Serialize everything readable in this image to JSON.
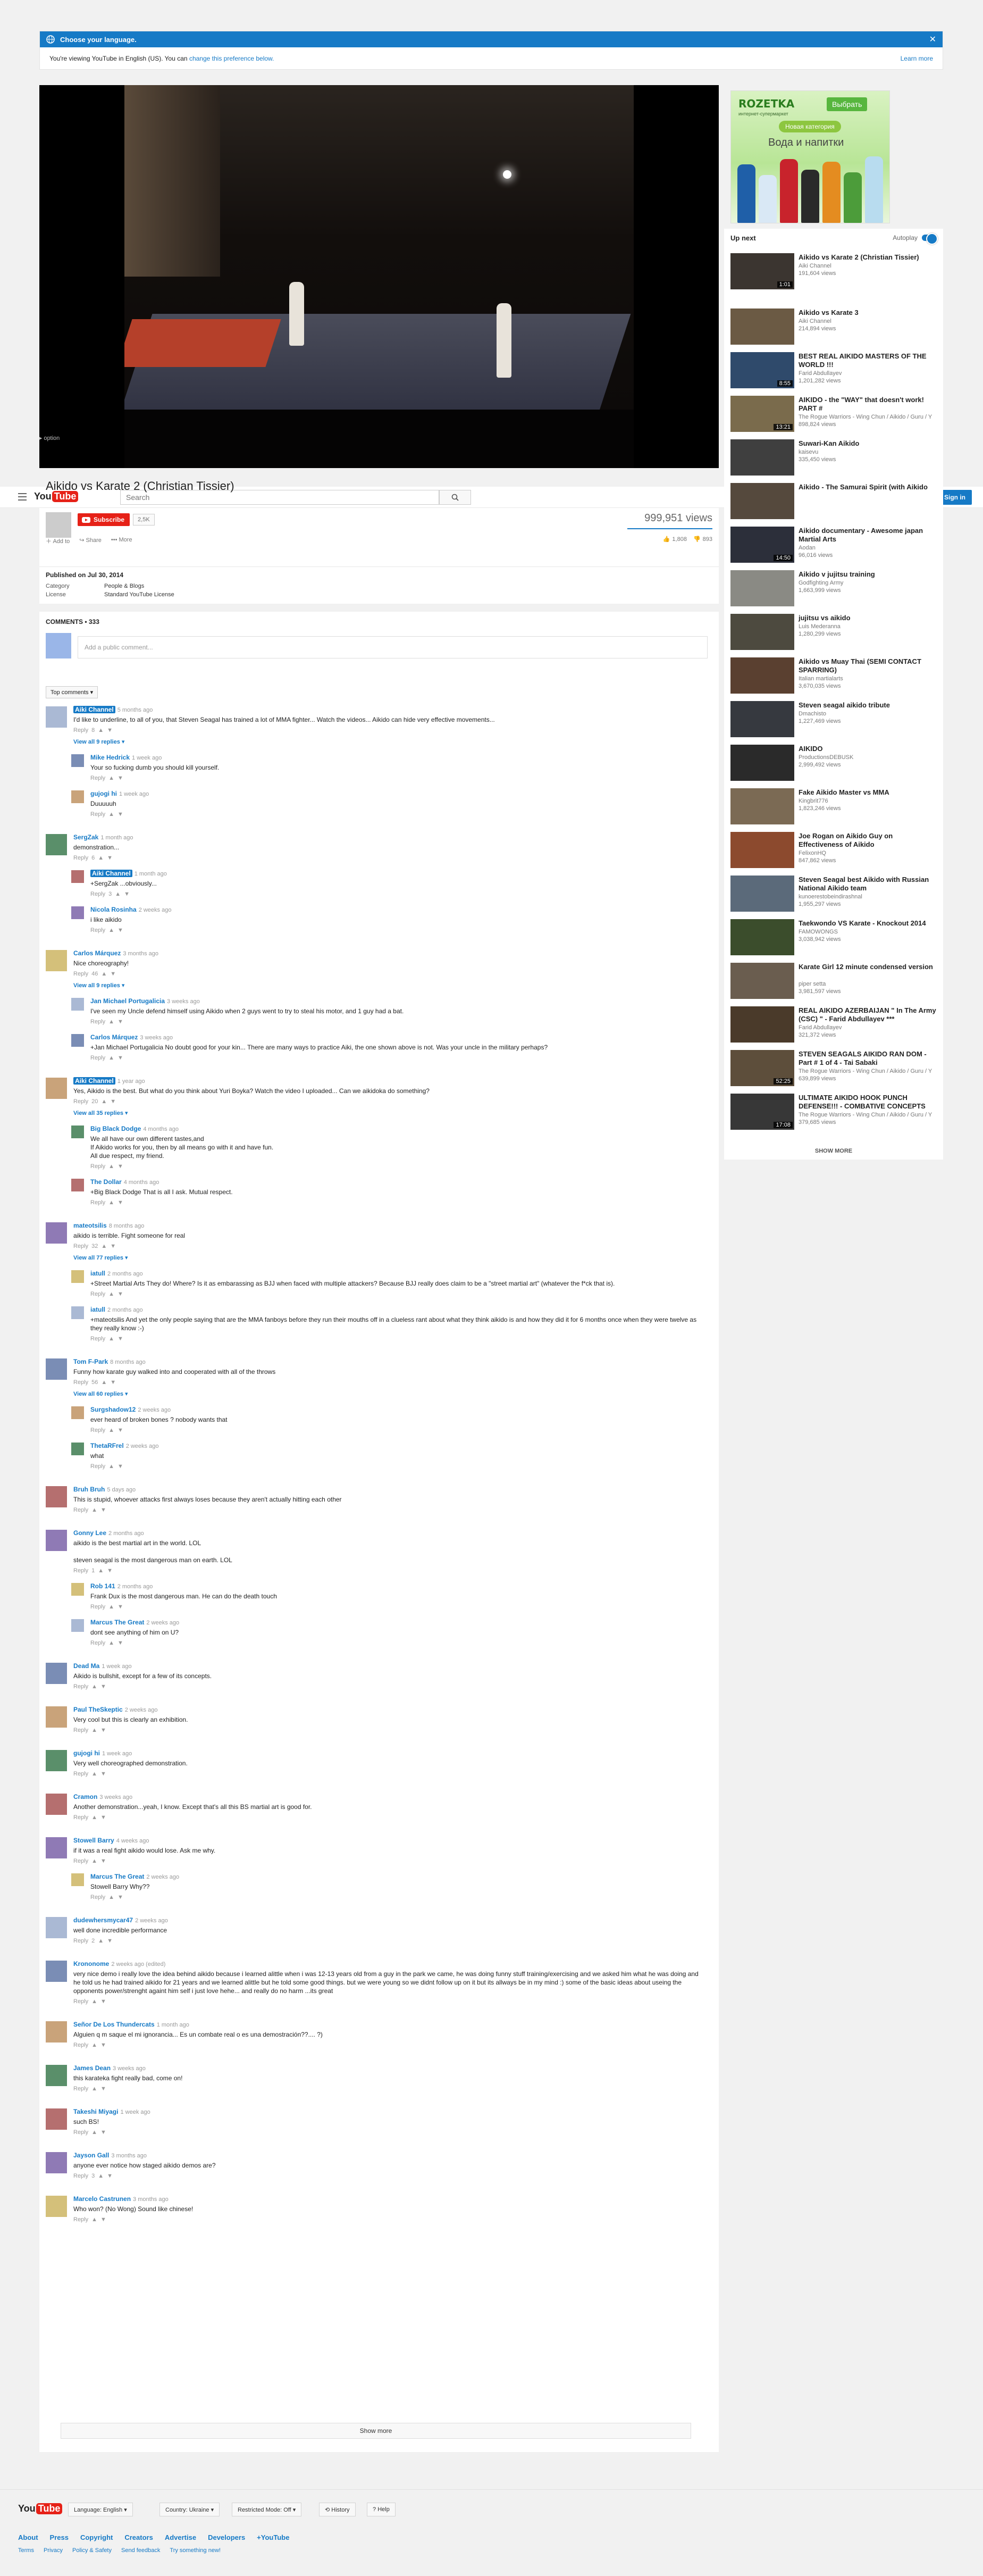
{
  "banner": {
    "title": "Choose your language.",
    "message": "You're viewing YouTube in English (US). You can",
    "change_link": "change this preference below.",
    "learn_more": "Learn more"
  },
  "player": {
    "skip_ad": "Skip ad ▸ option"
  },
  "ad": {
    "brand": "ROZETKA",
    "cta": "Выбрать",
    "sub": "интернет-супермаркет",
    "pill": "Новая категория",
    "headline": "Вода и напитки"
  },
  "masthead": {
    "logo_you": "You",
    "logo_tube": "Tube",
    "search_placeholder": "Search",
    "sign_in": "Sign in"
  },
  "video": {
    "title": "Aikido vs Karate 2 (Christian Tissier)",
    "subscribe": "Subscribe",
    "subscriber_count": "2,5K",
    "views": "999,951 views",
    "add_to": "Add to",
    "share": "Share",
    "more": "More",
    "likes": "1,808",
    "dislikes": "893",
    "published": "Published on Jul 30, 2014",
    "category_label": "Category",
    "category": "People & Blogs",
    "license_label": "License",
    "license": "Standard YouTube License"
  },
  "upnext": {
    "title": "Up next",
    "autoplay": "Autoplay",
    "show_more": "SHOW MORE",
    "items": [
      {
        "title": "Aikido vs Karate 2 (Christian Tissier)",
        "channel": "Aiki Channel",
        "views": "191,604 views",
        "duration": "1:01"
      },
      {
        "title": "Aikido vs Karate 3",
        "channel": "Aiki Channel",
        "views": "214,894 views",
        "duration": ""
      },
      {
        "title": "BEST REAL AIKIDO MASTERS OF THE WORLD !!!",
        "channel": "Farid Abdullayev",
        "views": "1,201,282 views",
        "duration": "8:55"
      },
      {
        "title": "AIKIDO - the \"WAY\" that doesn't work! PART #",
        "channel": "The Rogue Warriors - Wing Chun / Aikido / Guru / Y",
        "views": "898,824 views",
        "duration": "13:21"
      },
      {
        "title": "Suwari-Kan Aikido",
        "channel": "kaisevu",
        "views": "335,450 views",
        "duration": ""
      },
      {
        "title": "Aikido - The Samurai Spirit (with Aikido",
        "channel": "",
        "views": "",
        "duration": ""
      },
      {
        "title": "Aikido documentary - Awesome japan Martial Arts",
        "channel": "Aodan",
        "views": "96,016 views",
        "duration": "14:50"
      },
      {
        "title": "Aikido v jujitsu training",
        "channel": "Godfighting Army",
        "views": "1,663,999 views",
        "duration": ""
      },
      {
        "title": "jujitsu vs aikido",
        "channel": "Luis Mederanna",
        "views": "1,280,299 views",
        "duration": ""
      },
      {
        "title": "Aikido vs Muay Thai (SEMI CONTACT SPARRING)",
        "channel": "Italian martialarts",
        "views": "3,670,035 views",
        "duration": ""
      },
      {
        "title": "Steven seagal aikido tribute",
        "channel": "Dmachisto",
        "views": "1,227,469 views",
        "duration": ""
      },
      {
        "title": "AIKIDO",
        "channel": "ProductionsDEBUSK",
        "views": "2,999,492 views",
        "duration": ""
      },
      {
        "title": "Fake Aikido Master vs MMA",
        "channel": "Kingbrit776",
        "views": "1,823,246 views",
        "duration": ""
      },
      {
        "title": "Joe Rogan on Aikido Guy on Effectiveness of Aikido",
        "channel": "FelixonHQ",
        "views": "847,862 views",
        "duration": ""
      },
      {
        "title": "Steven Seagal best Aikido with Russian National Aikido team",
        "channel": "kunoerestobeindirashnal",
        "views": "1,955,297 views",
        "duration": ""
      },
      {
        "title": "Taekwondo VS Karate - Knockout 2014",
        "channel": "FAMOWONGS",
        "views": "3,038,942 views",
        "duration": ""
      },
      {
        "title": "Karate Girl 12 minute condensed version",
        "channel": "piper setta",
        "views": "3,981,597 views",
        "duration": ""
      },
      {
        "title": "REAL AIKIDO AZERBAIJAN \" In The Army (CSC) \" - Farid Abdullayev ***",
        "channel": "Farid Abdullayev",
        "views": "321,372 views",
        "duration": ""
      },
      {
        "title": "STEVEN SEAGALS AIKIDO RAN DOM - Part # 1 of 4 - Tai Sabaki",
        "channel": "The Rogue Warriors - Wing Chun / Aikido / Guru / Y",
        "views": "639,899 views",
        "duration": "52:25"
      },
      {
        "title": "ULTIMATE AIKIDO HOOK PUNCH DEFENSE!!! - COMBATIVE CONCEPTS",
        "channel": "The Rogue Warriors - Wing Chun / Aikido / Guru / Y",
        "views": "379,685 views",
        "duration": "17:08"
      }
    ]
  },
  "comments": {
    "header": "COMMENTS • 333",
    "add_placeholder": "Add a public comment...",
    "sort": "Top comments ▾",
    "show_more": "Show more",
    "items": [
      {
        "author": "Aiki Channel",
        "hl": true,
        "time": "5 months ago",
        "text": "I'd like to underline, to all of you, that Steven Seagal has trained a lot of MMA fighter... Watch the videos... Aikido can hide very effective movements...",
        "likes": "8",
        "view_all": "View all 9 replies ▾",
        "reply": false
      },
      {
        "author": "Mike Hedrick",
        "hl": false,
        "time": "1 week ago",
        "text": "Your so fucking dumb you should kill yourself.",
        "likes": "",
        "view_all": "",
        "reply": true
      },
      {
        "author": "gujogi hi",
        "hl": false,
        "time": "1 week ago",
        "text": "Duuuuuh",
        "likes": "",
        "view_all": "",
        "reply": true
      },
      {
        "author": "SergZak",
        "hl": false,
        "time": "1 month ago",
        "text": "demonstration...",
        "likes": "6",
        "view_all": "",
        "reply": false
      },
      {
        "author": "Aiki Channel",
        "hl": true,
        "time": "1 month ago",
        "text": "+SergZak ...obviously...",
        "likes": "3",
        "view_all": "",
        "reply": true
      },
      {
        "author": "Nicola Rosinha",
        "hl": false,
        "time": "2 weeks ago",
        "text": "i like aikido",
        "likes": "",
        "view_all": "",
        "reply": true
      },
      {
        "author": "Carlos Márquez",
        "hl": false,
        "time": "3 months ago",
        "text": "Nice choreography!",
        "likes": "46",
        "view_all": "View all 9 replies ▾",
        "reply": false
      },
      {
        "author": "Jan Michael Portugalicia",
        "hl": false,
        "time": "3 weeks ago",
        "text": "I've seen my Uncle defend himself  using Aikido when 2 guys went to try to steal his motor, and 1 guy had a bat.",
        "likes": "",
        "view_all": "",
        "reply": true
      },
      {
        "author": "Carlos Márquez",
        "hl": false,
        "time": "3 weeks ago",
        "text": "+Jan Michael Portugalicia No doubt good for your kin... There are many ways to practice Aiki, the one shown above is not. Was your uncle in the military perhaps?",
        "likes": "",
        "view_all": "",
        "reply": true
      },
      {
        "author": "Aiki Channel",
        "hl": true,
        "time": "1 year ago",
        "text": "Yes, Aikido is the best. But what do you think about Yuri Boyka? Watch the video I uploaded... Can we aikidoka do something?",
        "likes": "20",
        "view_all": "View all 35 replies ▾",
        "reply": false
      },
      {
        "author": "Big Black Dodge",
        "hl": false,
        "time": "4 months ago",
        "text": "We all have our own different tastes,and\nIf Aikido works for you, then by all means go with it and have fun.\nAll due respect, my friend.",
        "likes": "",
        "view_all": "",
        "reply": true
      },
      {
        "author": "The Dollar",
        "hl": false,
        "time": "4 months ago",
        "text": "+Big Black Dodge That is all I ask. Mutual respect.",
        "likes": "",
        "view_all": "",
        "reply": true
      },
      {
        "author": "mateotsilis",
        "hl": false,
        "time": "8 months ago",
        "text": "aikido is terrible. Fight someone for real",
        "likes": "32",
        "view_all": "View all 77 replies ▾",
        "reply": false
      },
      {
        "author": "iatull",
        "hl": false,
        "time": "2 months ago",
        "text": "+Street Martial Arts  They do!  Where?  Is it as embarassing as BJJ when faced with multiple attackers?  Because BJJ really does claim to be a \"street martial art\" (whatever the f*ck that is).",
        "likes": "",
        "view_all": "",
        "reply": true
      },
      {
        "author": "iatull",
        "hl": false,
        "time": "2 months ago",
        "text": "+mateotsilis   And yet the only people saying that are the MMA fanboys before they run their mouths off in a clueless rant about what they think aikido is and how they did it for 6 months once when they were twelve as they really know :-)",
        "likes": "",
        "view_all": "",
        "reply": true
      },
      {
        "author": "Tom F-Park",
        "hl": false,
        "time": "8 months ago",
        "text": "Funny how karate guy walked into and cooperated with all of the throws",
        "likes": "56",
        "view_all": "View all 60 replies ▾",
        "reply": false
      },
      {
        "author": "Surgshadow12",
        "hl": false,
        "time": "2 weeks ago",
        "text": "ever heard of broken bones ? nobody wants that",
        "likes": "",
        "view_all": "",
        "reply": true
      },
      {
        "author": "ThetaRFrel",
        "hl": false,
        "time": "2 weeks ago",
        "text": "what",
        "likes": "",
        "view_all": "",
        "reply": true
      },
      {
        "author": "Bruh Bruh",
        "hl": false,
        "time": "5 days ago",
        "text": "This is stupid, whoever attacks first always loses because they aren't actually hitting each other",
        "likes": "",
        "view_all": "",
        "reply": false
      },
      {
        "author": "Gonny Lee",
        "hl": false,
        "time": "2 months ago",
        "text": "aikido is the best martial art in the world. LOL\n\nsteven seagal is the most dangerous man on earth. LOL",
        "likes": "1",
        "view_all": "",
        "reply": false
      },
      {
        "author": "Rob 141",
        "hl": false,
        "time": "2 months ago",
        "text": "Frank Dux is the most dangerous man. He can do the death touch",
        "likes": "",
        "view_all": "",
        "reply": true
      },
      {
        "author": "Marcus The Great",
        "hl": false,
        "time": "2 weeks ago",
        "text": "dont see anything of him on U?",
        "likes": "",
        "view_all": "",
        "reply": true
      },
      {
        "author": "Dead Ma",
        "hl": false,
        "time": "1 week ago",
        "text": "Aikido is bullshit, except for a few of its concepts.",
        "likes": "",
        "view_all": "",
        "reply": false
      },
      {
        "author": "Paul TheSkeptic",
        "hl": false,
        "time": "2 weeks ago",
        "text": "Very cool but this is clearly an exhibition.",
        "likes": "",
        "view_all": "",
        "reply": false
      },
      {
        "author": "gujogi hi",
        "hl": false,
        "time": "1 week ago",
        "text": "Very well choreographed demonstration.",
        "likes": "",
        "view_all": "",
        "reply": false
      },
      {
        "author": "Cramon",
        "hl": false,
        "time": "3 weeks ago",
        "text": "Another demonstration...yeah, I know. Except that's all this BS martial art is good for.",
        "likes": "",
        "view_all": "",
        "reply": false
      },
      {
        "author": "Stowell Barry",
        "hl": false,
        "time": "4 weeks ago",
        "text": "if it was a real fight aikido would lose. Ask me why.",
        "likes": "",
        "view_all": "",
        "reply": false
      },
      {
        "author": "Marcus The Great",
        "hl": false,
        "time": "2 weeks ago",
        "text": "Stowell Barry Why??",
        "likes": "",
        "view_all": "",
        "reply": true
      },
      {
        "author": "dudewhersmycar47",
        "hl": false,
        "time": "2 weeks ago",
        "text": "well done incredible performance",
        "likes": "2",
        "view_all": "",
        "reply": false
      },
      {
        "author": "Krononome",
        "hl": false,
        "time": "2 weeks ago (edited)",
        "text": "very nice demo i really love the idea behind aikido because i learned alittle when i was 12-13 years old from a guy in the park we came, he was doing funny stuff  training/exercising and we asked him what he was doing and he told us he had trained aikido for 21 years and we learned alittle but he told some good things. but we were young so we didnt follow up on it but its allways be in my mind :)  some of the basic ideas about useing the opponents power/strenght againt him self i just love hehe... and really do no harm ...its great",
        "likes": "",
        "view_all": "",
        "reply": false
      },
      {
        "author": "Señor De Los Thundercats",
        "hl": false,
        "time": "1 month ago",
        "text": "Alguien q m saque el mi ignorancia... Es un combate real o es una demostración??.... ?)",
        "likes": "",
        "view_all": "",
        "reply": false
      },
      {
        "author": "James Dean",
        "hl": false,
        "time": "3 weeks ago",
        "text": "this karateka fight really bad, come on!",
        "likes": "",
        "view_all": "",
        "reply": false
      },
      {
        "author": "Takeshi Miyagi",
        "hl": false,
        "time": "1 week ago",
        "text": "such BS!",
        "likes": "",
        "view_all": "",
        "reply": false
      },
      {
        "author": "Jayson Gall",
        "hl": false,
        "time": "3 months ago",
        "text": "anyone ever notice how staged aikido demos are?",
        "likes": "3",
        "view_all": "",
        "reply": false
      },
      {
        "author": "Marcelo Castrunen",
        "hl": false,
        "time": "3 months ago",
        "text": "Who won? (No Wong) Sound like chinese!",
        "likes": "",
        "view_all": "",
        "reply": false
      }
    ]
  },
  "footer": {
    "language": "Language: English ▾",
    "country": "Country: Ukraine ▾",
    "restricted": "Restricted Mode: Off ▾",
    "history": "History",
    "help": "Help",
    "links": [
      "About",
      "Press",
      "Copyright",
      "Creators",
      "Advertise",
      "Developers",
      "+YouTube"
    ],
    "links2": [
      "Terms",
      "Privacy",
      "Policy & Safety",
      "Send feedback",
      "Try something new!"
    ]
  }
}
